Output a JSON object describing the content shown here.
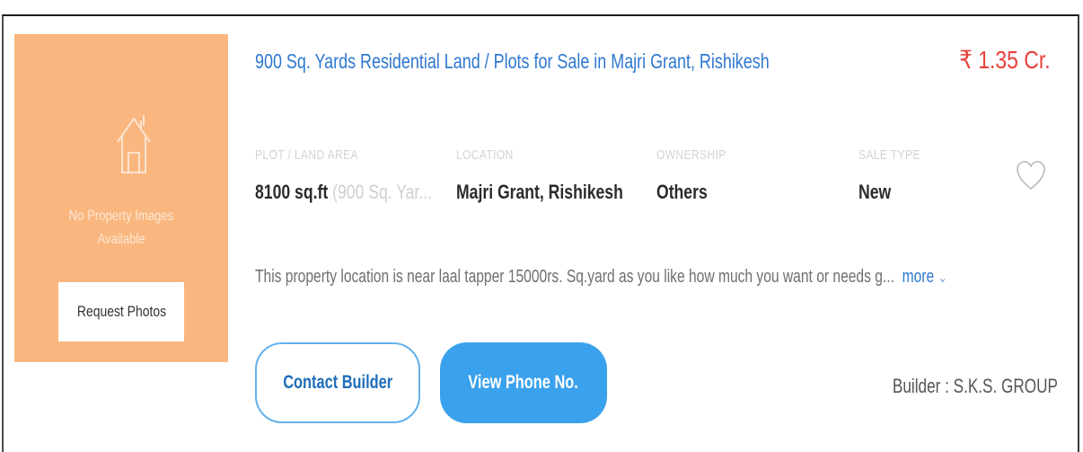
{
  "listing": {
    "title": "900 Sq. Yards Residential Land / Plots for Sale in Majri Grant, Rishikesh",
    "price": "₹ 1.35 Cr.",
    "image_placeholder": {
      "line1": "No Property Images",
      "line2": "Available",
      "icon": "house-icon"
    },
    "request_photos_label": "Request Photos",
    "facts": [
      {
        "label": "PLOT / LAND AREA",
        "value": "8100 sq.ft",
        "secondary": "(900 Sq. Yar..."
      },
      {
        "label": "LOCATION",
        "value": "Majri Grant, Rishikesh"
      },
      {
        "label": "OWNERSHIP",
        "value": "Others"
      },
      {
        "label": "SALE TYPE",
        "value": "New"
      }
    ],
    "shortlist_icon": "heart-icon",
    "description": "This property location is near laal tapper 15000rs. Sq.yard as you like how much you want or needs g...",
    "more_label": "more",
    "contact_builder_label": "Contact Builder",
    "view_phone_label": "View Phone No.",
    "builder_text": "Builder : S.K.S. GROUP"
  },
  "colors": {
    "accent_blue": "#2e78d0",
    "price_red": "#e8413b",
    "placeholder_orange": "#f9b77f",
    "button_blue": "#3aa1ec"
  }
}
